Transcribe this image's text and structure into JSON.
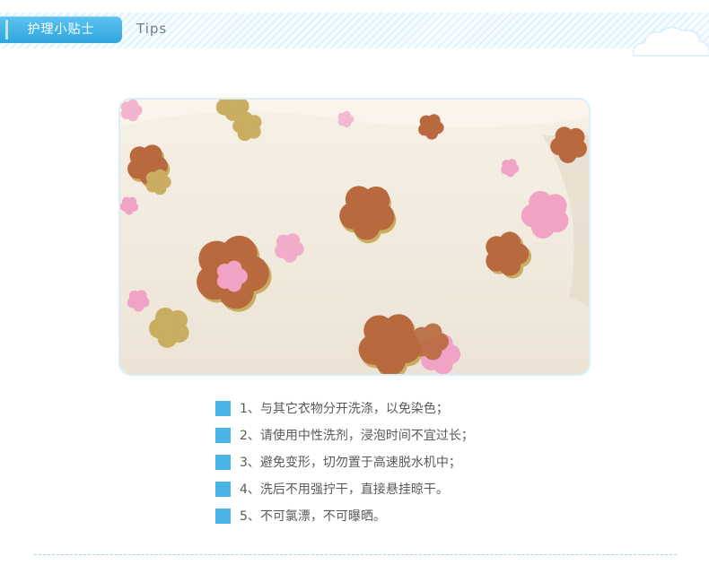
{
  "header": {
    "title": "护理小贴士",
    "subtitle": "Tips"
  },
  "photo": {
    "subject": "fabric-closeup"
  },
  "tips": [
    "1、与其它衣物分开洗涤，以免染色；",
    "2、请使用中性洗剂，浸泡时间不宜过长；",
    "3、避免变形，切勿置于高速脱水机中；",
    "4、洗后不用强拧干，直接悬挂晾干。",
    "5、不可氯漂，不可曝晒。"
  ],
  "colors": {
    "accent": "#2fa5dd",
    "bullet": "#49b4e6",
    "text": "#5a5a5a",
    "flower_brown": "#b8693e",
    "flower_pink": "#f1a3c6",
    "flower_olive": "#c9ad60"
  }
}
